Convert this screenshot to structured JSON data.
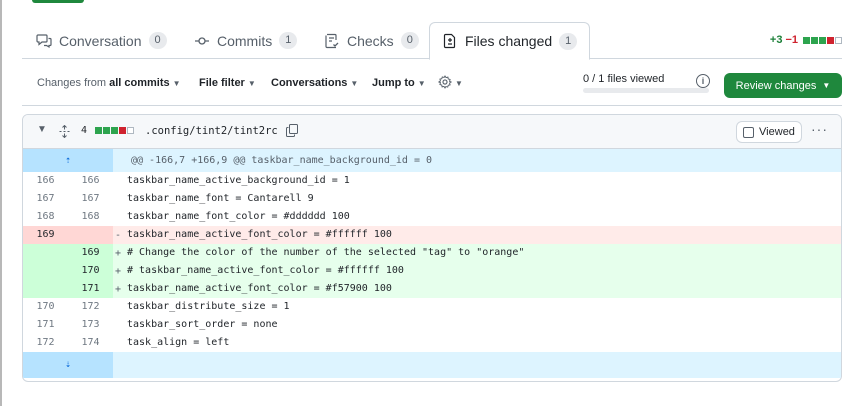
{
  "tabs": [
    {
      "label": "Conversation",
      "count": "0",
      "icon": "comment-discussion-icon"
    },
    {
      "label": "Commits",
      "count": "1",
      "icon": "git-commit-icon"
    },
    {
      "label": "Checks",
      "count": "0",
      "icon": "checklist-icon"
    },
    {
      "label": "Files changed",
      "count": "1",
      "icon": "file-diff-icon"
    }
  ],
  "diffstat": {
    "additions": "+3",
    "deletions": "−1"
  },
  "toolbar": {
    "changes_prefix": "Changes from",
    "changes_value": "all commits",
    "file_filter": "File filter",
    "conversations": "Conversations",
    "jump_to": "Jump to",
    "files_viewed": "0 / 1 files viewed",
    "review_button": "Review changes"
  },
  "file": {
    "changes": "4",
    "path": ".config/tint2/tint2rc",
    "viewed_label": "Viewed"
  },
  "diff": {
    "hunk_header": "@@ -166,7 +166,9 @@ taskbar_name_background_id = 0",
    "lines": [
      {
        "type": "ctx",
        "old": "166",
        "new": "166",
        "sign": "",
        "code": "taskbar_name_active_background_id = 1"
      },
      {
        "type": "ctx",
        "old": "167",
        "new": "167",
        "sign": "",
        "code": "taskbar_name_font = Cantarell 9"
      },
      {
        "type": "ctx",
        "old": "168",
        "new": "168",
        "sign": "",
        "code": "taskbar_name_font_color = #dddddd 100"
      },
      {
        "type": "del",
        "old": "169",
        "new": "",
        "sign": "-",
        "code": "taskbar_name_active_font_color = #ffffff 100"
      },
      {
        "type": "add",
        "old": "",
        "new": "169",
        "sign": "+",
        "code": "# Change the color of the number of the selected \"tag\" to \"orange\""
      },
      {
        "type": "add",
        "old": "",
        "new": "170",
        "sign": "+",
        "code": "# taskbar_name_active_font_color = #ffffff 100"
      },
      {
        "type": "add",
        "old": "",
        "new": "171",
        "sign": "+",
        "code": "taskbar_name_active_font_color = #f57900 100"
      },
      {
        "type": "ctx",
        "old": "170",
        "new": "172",
        "sign": "",
        "code": "taskbar_distribute_size = 1"
      },
      {
        "type": "ctx",
        "old": "171",
        "new": "173",
        "sign": "",
        "code": "taskbar_sort_order = none"
      },
      {
        "type": "ctx",
        "old": "172",
        "new": "174",
        "sign": "",
        "code": "task_align = left"
      }
    ]
  },
  "colors": {
    "accent_green": "#1f883d",
    "addition": "#1a7f37",
    "deletion": "#cf222e",
    "hunk_bg": "#ddf4ff"
  }
}
